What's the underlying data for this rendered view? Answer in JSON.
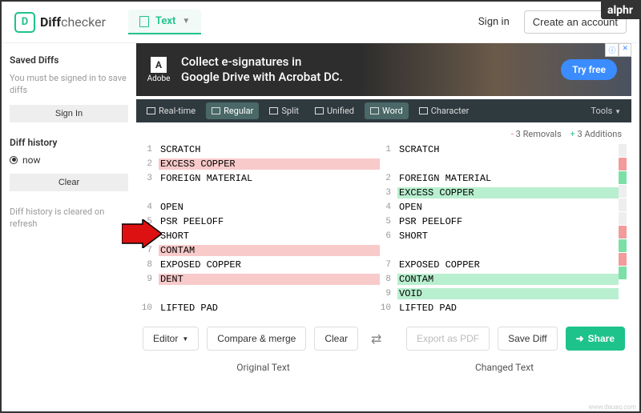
{
  "watermark": {
    "top_right": "alphr",
    "bottom_right": "www.deuaq.com"
  },
  "header": {
    "brand_bold": "Diff",
    "brand_light": "checker",
    "mode_label": "Text",
    "sign_in": "Sign in",
    "create_account": "Create an account"
  },
  "sidebar": {
    "saved_title": "Saved Diffs",
    "saved_msg": "You must be signed in to save diffs",
    "sign_in_btn": "Sign In",
    "history_title": "Diff history",
    "history_now": "now",
    "clear_btn": "Clear",
    "history_msg": "Diff history is cleared on refresh"
  },
  "ad": {
    "brand": "Adobe",
    "line1": "Collect e-signatures in",
    "line2": "Google Drive with Acrobat DC.",
    "cta": "Try free"
  },
  "toolbar": {
    "realtime": "Real-time",
    "regular": "Regular",
    "split": "Split",
    "unified": "Unified",
    "word": "Word",
    "character": "Character",
    "tools": "Tools"
  },
  "stats": {
    "removals": "3 Removals",
    "additions": "3 Additions"
  },
  "diff": {
    "left": [
      {
        "n": "1",
        "t": "SCRATCH",
        "c": ""
      },
      {
        "n": "2",
        "t": "EXCESS COPPER",
        "c": "removed"
      },
      {
        "n": "3",
        "t": "FOREIGN MATERIAL",
        "c": ""
      },
      {
        "n": "",
        "t": "",
        "c": "blank"
      },
      {
        "n": "4",
        "t": "OPEN",
        "c": ""
      },
      {
        "n": "5",
        "t": "PSR PEELOFF",
        "c": ""
      },
      {
        "n": "6",
        "t": "SHORT",
        "c": ""
      },
      {
        "n": "7",
        "t": "CONTAM",
        "c": "removed"
      },
      {
        "n": "8",
        "t": "EXPOSED COPPER",
        "c": ""
      },
      {
        "n": "9",
        "t": "DENT",
        "c": "removed"
      },
      {
        "n": "",
        "t": "",
        "c": "blank"
      },
      {
        "n": "10",
        "t": "LIFTED PAD",
        "c": ""
      }
    ],
    "right": [
      {
        "n": "1",
        "t": "SCRATCH",
        "c": ""
      },
      {
        "n": "",
        "t": "",
        "c": "blank"
      },
      {
        "n": "2",
        "t": "FOREIGN MATERIAL",
        "c": ""
      },
      {
        "n": "3",
        "t": "EXCESS COPPER",
        "c": "added"
      },
      {
        "n": "4",
        "t": "OPEN",
        "c": ""
      },
      {
        "n": "5",
        "t": "PSR PEELOFF",
        "c": ""
      },
      {
        "n": "6",
        "t": "SHORT",
        "c": ""
      },
      {
        "n": "",
        "t": "",
        "c": "blank"
      },
      {
        "n": "7",
        "t": "EXPOSED COPPER",
        "c": ""
      },
      {
        "n": "8",
        "t": "CONTAM",
        "c": "added"
      },
      {
        "n": "9",
        "t": "VOID",
        "c": "added"
      },
      {
        "n": "10",
        "t": "LIFTED PAD",
        "c": ""
      }
    ]
  },
  "bottom": {
    "editor": "Editor",
    "compare": "Compare & merge",
    "clear": "Clear",
    "export": "Export as PDF",
    "save": "Save Diff",
    "share": "Share"
  },
  "columns": {
    "left": "Original Text",
    "right": "Changed Text"
  }
}
